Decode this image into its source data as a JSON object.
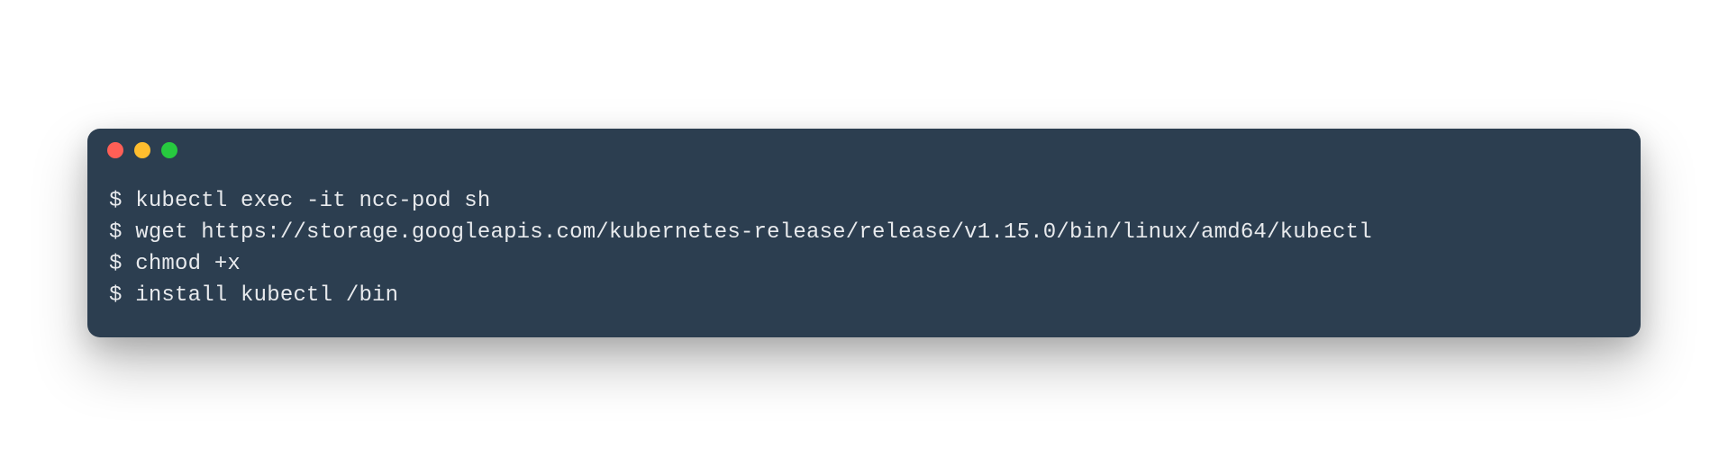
{
  "terminal": {
    "prompt": "$ ",
    "lines": [
      {
        "command": "kubectl exec -it ncc-pod sh"
      },
      {
        "command": "wget https://storage.googleapis.com/kubernetes-release/release/v1.15.0/bin/linux/amd64/kubectl"
      },
      {
        "command": "chmod +x"
      },
      {
        "command": "install kubectl /bin"
      }
    ],
    "colors": {
      "background": "#2c3e50",
      "text": "#e8eaed",
      "close": "#ff5f56",
      "minimize": "#ffbd2e",
      "zoom": "#27c93f"
    }
  }
}
